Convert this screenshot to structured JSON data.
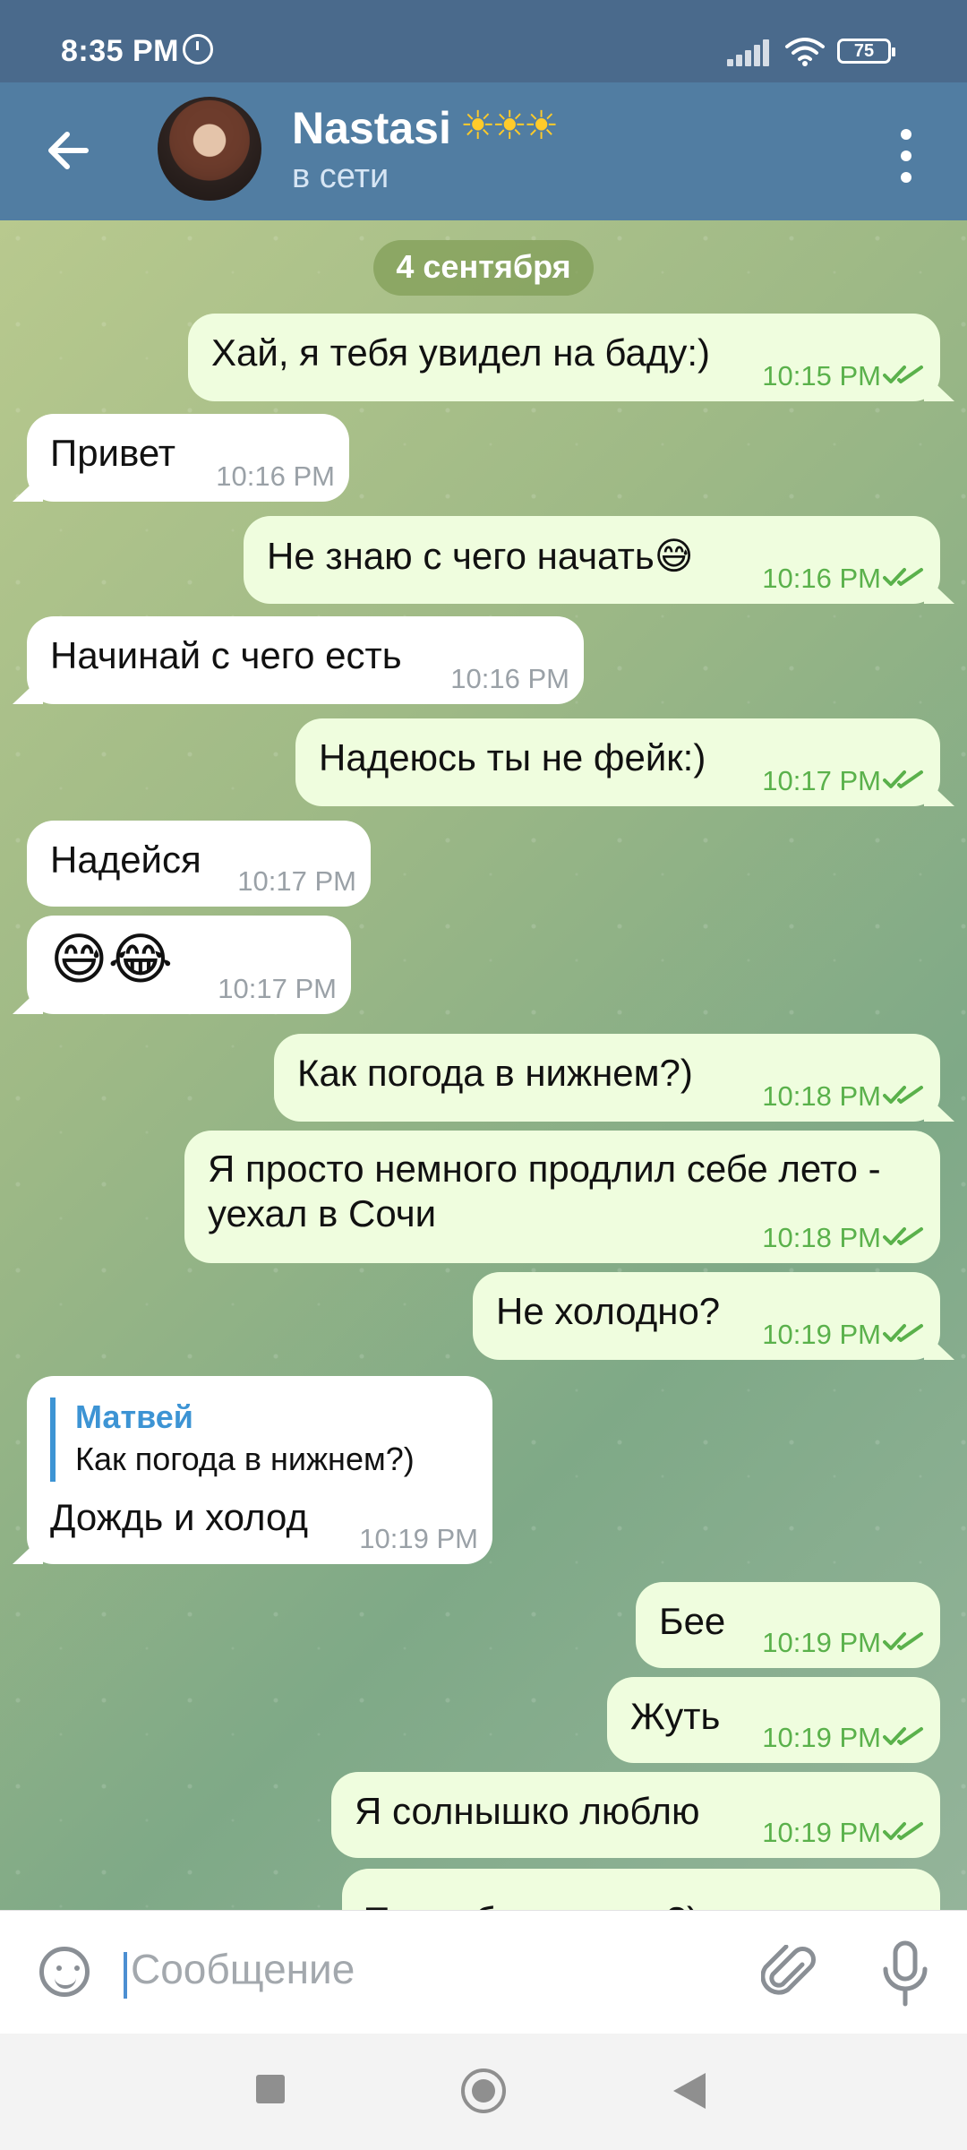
{
  "status": {
    "time": "8:35 PM",
    "battery": "75"
  },
  "contact": {
    "name": "Nastasi",
    "emoji": "☀☀☀",
    "status": "в сети"
  },
  "date_divider": "4 сентября",
  "messages": [
    {
      "text": "Хай, я тебя увидел на баду:)",
      "time": "10:15 PM"
    },
    {
      "text": "Привет",
      "time": "10:16 PM"
    },
    {
      "text": "Не знаю с чего начать😅",
      "time": "10:16 PM"
    },
    {
      "text": "Начинай с чего есть",
      "time": "10:16 PM"
    },
    {
      "text": "Надеюсь ты не фейк:)",
      "time": "10:17 PM"
    },
    {
      "text": "Надейся",
      "time": "10:17 PM"
    },
    {
      "text": "😅😂",
      "time": "10:17 PM"
    },
    {
      "text": "Как погода в нижнем?)",
      "time": "10:18 PM"
    },
    {
      "text": "Я просто немного продлил себе лето - уехал в Сочи",
      "time": "10:18 PM"
    },
    {
      "text": "Не холодно?",
      "time": "10:19 PM"
    },
    {
      "quote_name": "Матвей",
      "quote_text": "Как погода в нижнем?)",
      "text": "Дождь и холод",
      "time": "10:19 PM"
    },
    {
      "text": "Бее",
      "time": "10:19 PM"
    },
    {
      "text": "Жуть",
      "time": "10:19 PM"
    },
    {
      "text": "Я солнышко люблю",
      "time": "10:19 PM"
    },
    {
      "text": "Ты любишь суши?)"
    }
  ],
  "composer": {
    "placeholder": "Сообщение"
  },
  "icons": {
    "back": "arrow-left-icon",
    "menu": "more-vertical-icon",
    "emoji": "smile-icon",
    "attach": "paperclip-icon",
    "mic": "microphone-icon",
    "read": "double-check-icon"
  }
}
